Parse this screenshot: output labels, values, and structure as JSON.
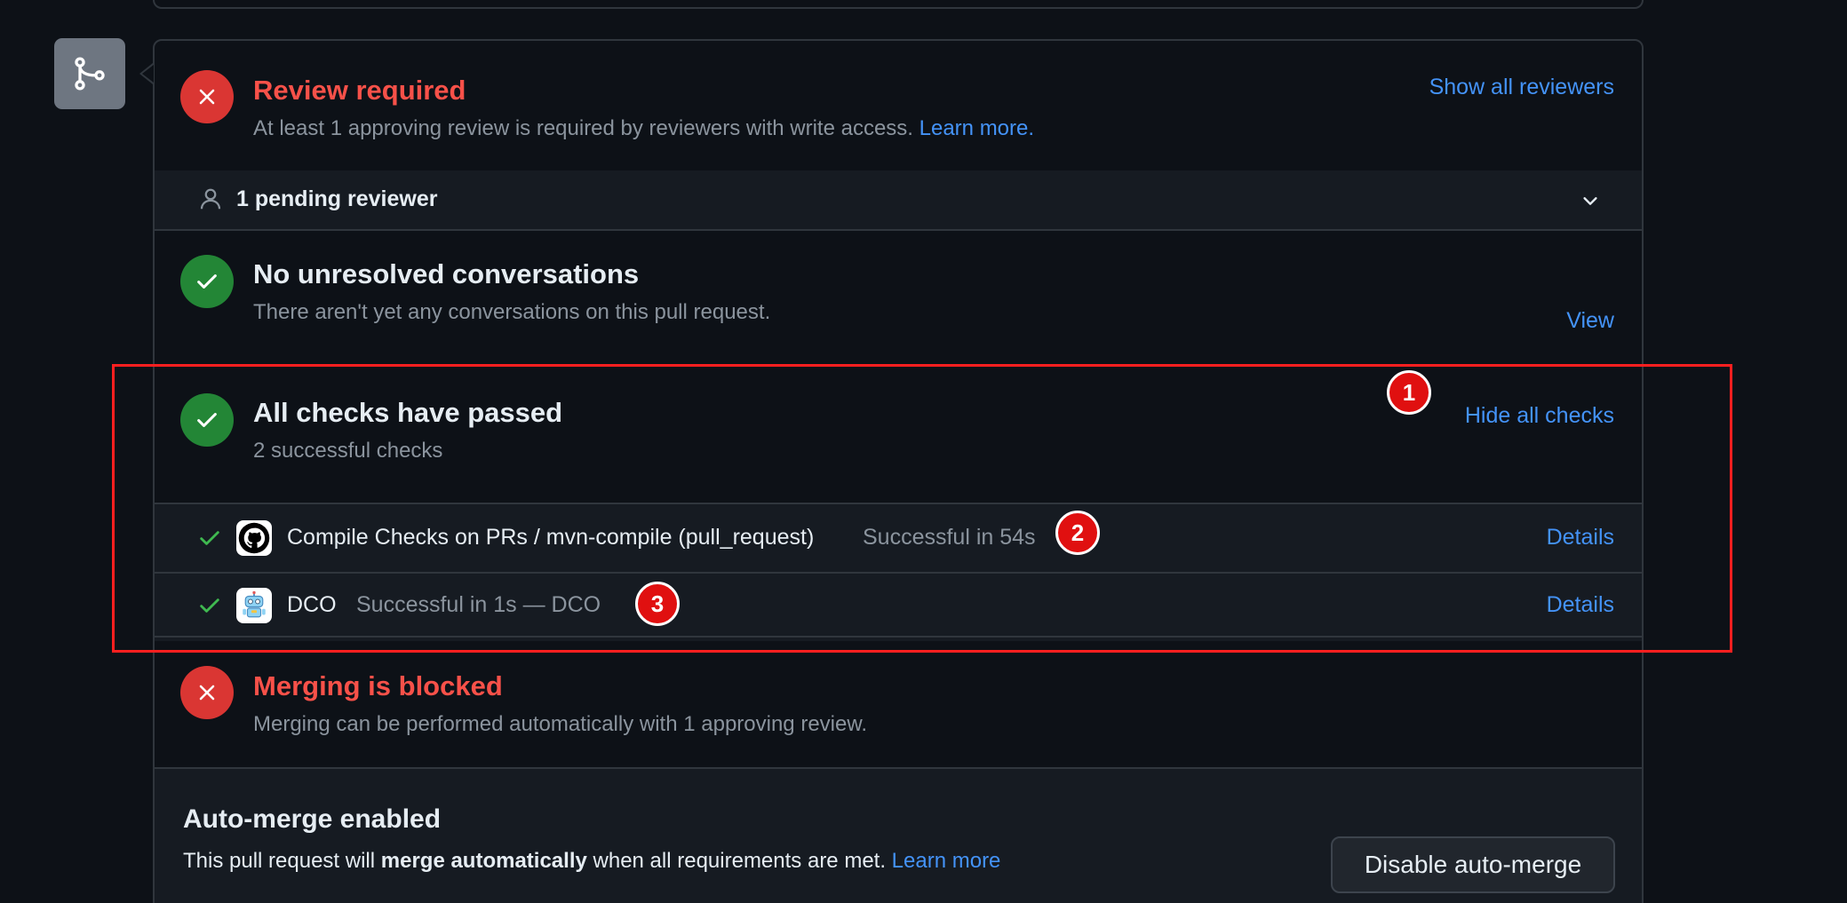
{
  "review": {
    "title": "Review required",
    "description": "At least 1 approving review is required by reviewers with write access.",
    "learn_more": "Learn more.",
    "show_all": "Show all reviewers",
    "pending_label": "1 pending reviewer"
  },
  "conversations": {
    "title": "No unresolved conversations",
    "description": "There aren't yet any conversations on this pull request.",
    "view": "View"
  },
  "checks": {
    "title": "All checks have passed",
    "description": "2 successful checks",
    "hide_all": "Hide all checks",
    "items": [
      {
        "name": "Compile Checks on PRs / mvn-compile (pull_request)",
        "status": "Successful in 54s",
        "details": "Details",
        "icon": "github-icon"
      },
      {
        "name": "DCO",
        "status": "Successful in 1s — DCO",
        "details": "Details",
        "icon": "dco-bot-icon"
      }
    ]
  },
  "merge": {
    "title": "Merging is blocked",
    "description": "Merging can be performed automatically with 1 approving review."
  },
  "automerge": {
    "title": "Auto-merge enabled",
    "desc_pre": "This pull request will ",
    "desc_bold": "merge automatically",
    "desc_post": " when all requirements are met.",
    "learn_more": "Learn more",
    "button": "Disable auto-merge"
  },
  "annotations": [
    "1",
    "2",
    "3"
  ],
  "colors": {
    "background": "#0d1117",
    "error": "#da3633",
    "success": "#238636",
    "link": "#4493f8",
    "annotation": "#ff1f1f"
  }
}
